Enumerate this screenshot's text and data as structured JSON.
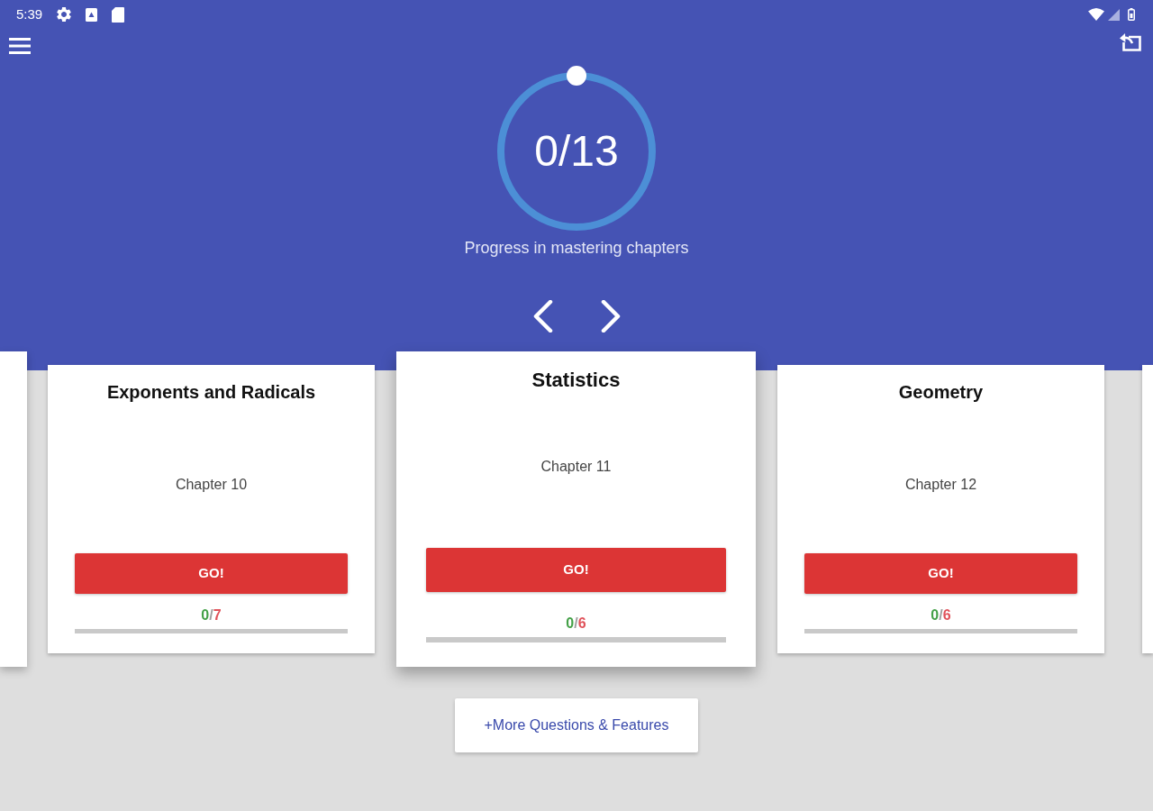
{
  "status_bar": {
    "time": "5:39"
  },
  "progress": {
    "value": "0/13",
    "caption": "Progress in mastering chapters"
  },
  "chapters": [
    {
      "title": "Exponents and Radicals",
      "chapter": "Chapter 10",
      "button": "GO!",
      "selected": false,
      "level": 0,
      "score": [
        {
          "kind": "mastered",
          "text": "0"
        },
        {
          "kind": "separator",
          "text": "/"
        },
        {
          "kind": "total",
          "text": "7"
        }
      ]
    },
    {
      "title": "Statistics",
      "chapter": "Chapter 11",
      "button": "GO!",
      "selected": true,
      "level": 0,
      "score": [
        {
          "kind": "mastered",
          "text": "0"
        },
        {
          "kind": "separator",
          "text": "/"
        },
        {
          "kind": "total",
          "text": "6"
        }
      ]
    },
    {
      "title": "Geometry",
      "chapter": "Chapter 12",
      "button": "GO!",
      "selected": false,
      "level": 0,
      "score": [
        {
          "kind": "mastered",
          "text": "0"
        },
        {
          "kind": "separator",
          "text": "/"
        },
        {
          "kind": "total",
          "text": "6"
        }
      ]
    }
  ],
  "more_button": {
    "label": "+More Questions & Features"
  }
}
